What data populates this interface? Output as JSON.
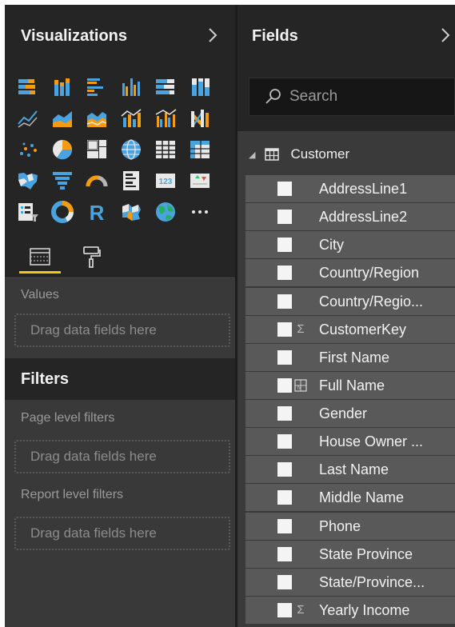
{
  "visualizations": {
    "title": "Visualizations",
    "collapse_icon": "chevron-right-icon",
    "gallery": [
      "stacked-bar-chart-icon",
      "stacked-column-chart-icon",
      "clustered-bar-chart-icon",
      "clustered-column-chart-icon",
      "100-stacked-bar-chart-icon",
      "100-stacked-column-chart-icon",
      "line-chart-icon",
      "area-chart-icon",
      "stacked-area-chart-icon",
      "line-and-stacked-column-icon",
      "line-and-clustered-column-icon",
      "ribbon-chart-icon",
      "scatter-chart-icon",
      "pie-chart-icon",
      "treemap-icon",
      "map-icon",
      "table-icon",
      "matrix-icon",
      "filled-map-icon",
      "funnel-icon",
      "gauge-icon",
      "multi-row-card-icon",
      "card-icon",
      "kpi-icon",
      "slicer-icon",
      "donut-chart-icon",
      "r-script-visual-icon",
      "shape-map-icon",
      "globe-map-icon",
      "more-options-icon"
    ],
    "tabs": [
      "fields-tab-icon",
      "format-paint-roller-icon"
    ],
    "values_label": "Values",
    "dropzone_text": "Drag data fields here"
  },
  "filters": {
    "title": "Filters",
    "page_label": "Page level filters",
    "page_dropzone": "Drag data fields here",
    "report_label": "Report level filters",
    "report_dropzone": "Drag data fields here"
  },
  "fields_pane": {
    "title": "Fields",
    "collapse_icon": "chevron-right-icon",
    "search_placeholder": "Search",
    "table_name": "Customer",
    "fields": [
      {
        "name": "AddressLine1",
        "type": ""
      },
      {
        "name": "AddressLine2",
        "type": ""
      },
      {
        "name": "City",
        "type": ""
      },
      {
        "name": "Country/Region",
        "type": ""
      },
      {
        "name": "Country/Regio...",
        "type": ""
      },
      {
        "name": "CustomerKey",
        "type": "Σ"
      },
      {
        "name": "First Name",
        "type": ""
      },
      {
        "name": "Full Name",
        "type": "calc"
      },
      {
        "name": "Gender",
        "type": ""
      },
      {
        "name": "House Owner ...",
        "type": ""
      },
      {
        "name": "Last Name",
        "type": ""
      },
      {
        "name": "Middle Name",
        "type": ""
      },
      {
        "name": "Phone",
        "type": ""
      },
      {
        "name": "State Province",
        "type": ""
      },
      {
        "name": "State/Province...",
        "type": ""
      },
      {
        "name": "Yearly Income",
        "type": "Σ"
      }
    ]
  },
  "colors": {
    "accent": "#f2c811",
    "pane_dark": "#252525",
    "pane_mid": "#393939",
    "field_row": "#595959",
    "icon_blue": "#4aa3df",
    "icon_orange": "#f39c12"
  }
}
